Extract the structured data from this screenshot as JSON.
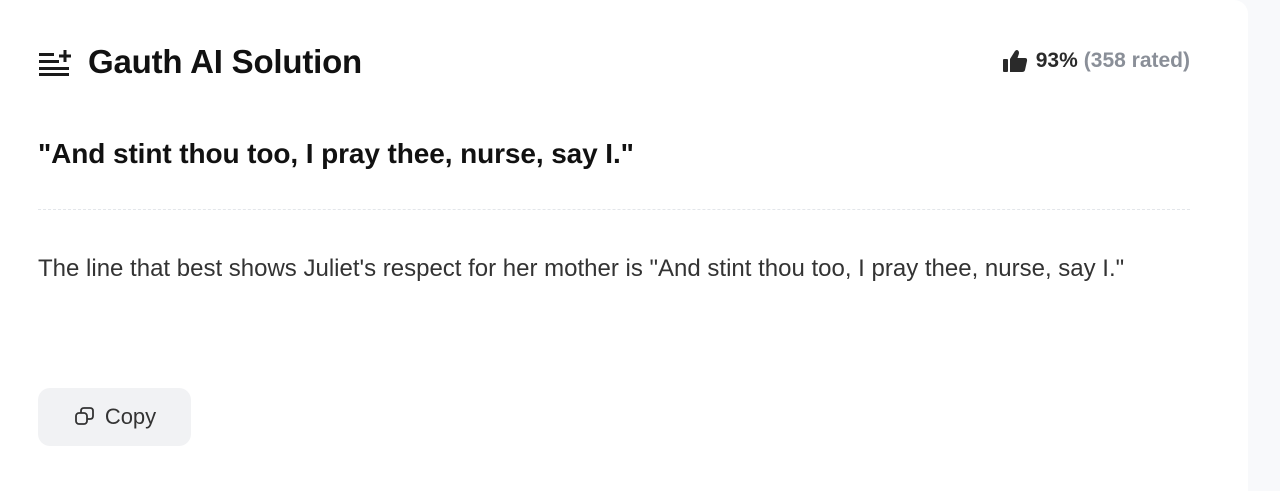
{
  "solution": {
    "title": "Gauth AI Solution",
    "title_icon": "ai-list-icon",
    "rating_icon": "thumbs-up-icon",
    "rating_percent": "93%",
    "rating_count": "(358 rated)",
    "question": "\"And stint thou too, I pray thee, nurse, say I.\"",
    "answer": "The line that best shows Juliet's respect for her mother is \"And stint thou too, I pray thee, nurse, say I.\"",
    "copy_label": "Copy",
    "copy_icon": "copy-icon"
  },
  "colors": {
    "text": "#111111",
    "muted": "#8a8f98",
    "button_bg": "#f1f2f4",
    "page_bg": "#f8f9fb"
  }
}
